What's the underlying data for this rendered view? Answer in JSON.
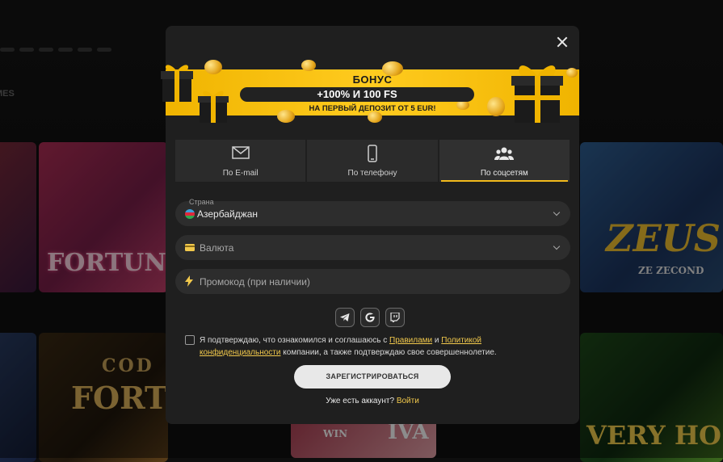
{
  "background": {
    "nav_label": "MES",
    "tiles": [
      {
        "text": "FORTUN"
      },
      {
        "text": "ZEUS"
      },
      {
        "text": "ZE ZECOND"
      },
      {
        "text": "COD"
      },
      {
        "text": "FORTU"
      },
      {
        "text": "VERY HO"
      },
      {
        "text": "WIN"
      },
      {
        "text": "IVA"
      }
    ]
  },
  "modal": {
    "bonus": {
      "title": "БОНУС",
      "headline": "+100% И 100 FS",
      "subtitle": "НА ПЕРВЫЙ ДЕПОЗИТ ОТ 5 EUR!"
    },
    "tabs": [
      {
        "label": "По E-mail",
        "icon": "envelope-icon"
      },
      {
        "label": "По телефону",
        "icon": "phone-icon"
      },
      {
        "label": "По соцсетям",
        "icon": "users-icon",
        "active": true
      }
    ],
    "country": {
      "label": "Страна",
      "value": "Азербайджан"
    },
    "currency": {
      "placeholder": "Валюта"
    },
    "promo": {
      "placeholder": "Промокод (при наличии)"
    },
    "social_buttons": [
      "telegram-icon",
      "google-icon",
      "twitch-icon"
    ],
    "consent": {
      "prefix": "Я подтверждаю, что ознакомился и соглашаюсь с",
      "rules_link": "Правилами",
      "and": "и",
      "privacy_link": "Политикой конфиденциальности",
      "suffix": "компании, а также подтверждаю свое совершеннолетие."
    },
    "register_button": "ЗАРЕГИСТРИРОВАТЬСЯ",
    "login": {
      "question": "Уже есть аккаунт?",
      "link": "Войти"
    }
  },
  "colors": {
    "accent": "#f2c94c",
    "banner": "#ffc21a",
    "modal_bg": "#1f1f1f",
    "field_bg": "#2d2d2d"
  }
}
